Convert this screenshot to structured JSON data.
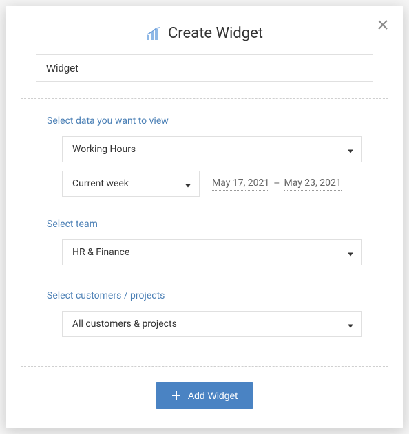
{
  "header": {
    "title": "Create Widget"
  },
  "name_input": {
    "value": "Widget"
  },
  "sections": {
    "data": {
      "label": "Select data you want to view",
      "metric": "Working Hours",
      "period": "Current week",
      "date_from": "May 17, 2021",
      "date_sep": "–",
      "date_to": "May 23, 2021"
    },
    "team": {
      "label": "Select team",
      "value": "HR & Finance"
    },
    "customers": {
      "label": "Select customers / projects",
      "value": "All customers & projects"
    }
  },
  "footer": {
    "add_label": "Add Widget"
  }
}
